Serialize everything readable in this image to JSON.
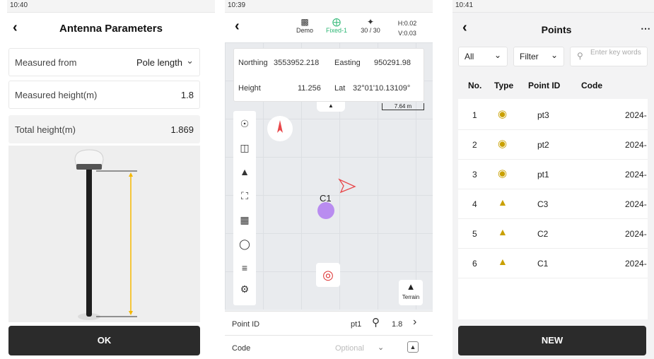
{
  "antenna": {
    "status_time": "10:40",
    "title": "Antenna Parameters",
    "measured_from_label": "Measured from",
    "measured_from_value": "Pole length",
    "measured_height_label": "Measured height(m)",
    "measured_height_value": "1.8",
    "total_height_label": "Total height(m)",
    "total_height_value": "1.869",
    "ok_label": "OK"
  },
  "survey": {
    "status_time": "10:39",
    "project_label": "Demo",
    "fix_label": "Fixed-1",
    "sats_label": "30 / 30",
    "h_label": "H:0.02",
    "v_label": "V:0.03",
    "northing_label": "Northing",
    "northing_value": "3553952.218",
    "easting_label": "Easting",
    "easting_value": "950291.98",
    "height_label": "Height",
    "height_value": "11.256",
    "lat_label": "Lat",
    "lat_value": "32°01'10.13109°",
    "scale_label": "7.64 m",
    "point_label_on_map": "C1",
    "terrain_label": "Terrain",
    "point_id_label": "Point ID",
    "point_id_value": "pt1",
    "antenna_height_value": "1.8",
    "code_label": "Code",
    "code_placeholder": "Optional",
    "colors": {
      "fixed": "#2bb673",
      "point": "#b98cf0",
      "arrow": "#e8474a"
    }
  },
  "points": {
    "status_time": "10:41",
    "title": "Points",
    "filter_all": "All",
    "filter_label": "Filter",
    "search_placeholder": "Enter key words",
    "columns": [
      "No.",
      "Type",
      "Point ID",
      "Code"
    ],
    "rows": [
      {
        "no": "1",
        "id": "pt3",
        "code": "2024-"
      },
      {
        "no": "2",
        "id": "pt2",
        "code": "2024-"
      },
      {
        "no": "3",
        "id": "pt1",
        "code": "2024-"
      },
      {
        "no": "4",
        "id": "C3",
        "code": "2024-"
      },
      {
        "no": "5",
        "id": "C2",
        "code": "2024-"
      },
      {
        "no": "6",
        "id": "C1",
        "code": "2024-"
      }
    ],
    "new_label": "NEW"
  }
}
